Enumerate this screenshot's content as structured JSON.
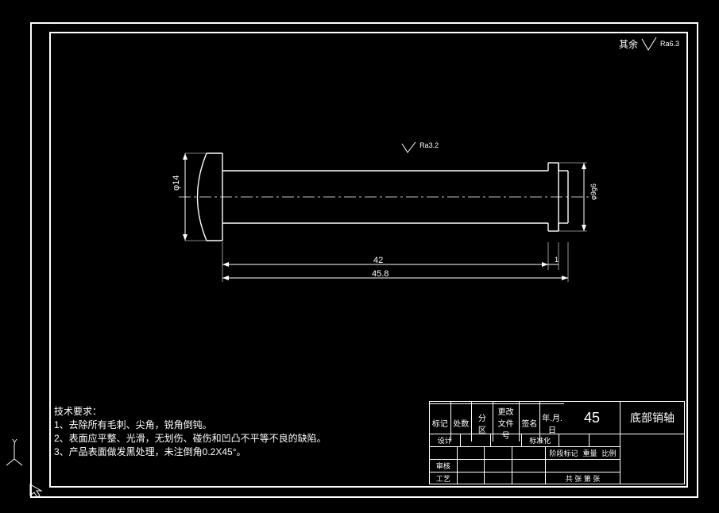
{
  "frame": {},
  "surface_finish": {
    "prefix": "其余",
    "value": "Ra6.3"
  },
  "main_roughness": "Ra3.2",
  "dimensions": {
    "d1": "φ14",
    "d2": "φ9g6",
    "len1": "42",
    "len2": "45.8",
    "len3": "1"
  },
  "tech_req": {
    "title": "技术要求：",
    "line1": "1、去除所有毛刺、尖角，锐角倒钝。",
    "line2": "2、表面应平整、光滑，无划伤、碰伤和凹凸不平等不良的缺陷。",
    "line3": "3、产品表面做发黑处理，未注倒角0.2X45°。"
  },
  "titleblock": {
    "material": "45",
    "part_name": "底部销轴",
    "row_hdr": {
      "c1": "标记",
      "c2": "处数",
      "c3": "分 区",
      "c4": "更改文件号",
      "c5": "签名",
      "c6": "年.月.日"
    },
    "rows": {
      "r1": "设计",
      "r1b": "标准化",
      "r2": "审核",
      "r3": "工艺"
    },
    "rlabels": {
      "a": "阶段标记",
      "b": "重量",
      "c": "比例"
    },
    "footer": "共    张 第    张"
  },
  "crosshair": "Y",
  "chart_data": {
    "type": "engineering_drawing",
    "part": "底部销轴 (bottom pin shaft)",
    "material": "45 steel",
    "overall_length_mm": 45.8,
    "main_shaft_length_mm": 42,
    "end_collar_width_mm": 1,
    "head_diameter_mm": 14,
    "shaft_diameter": "φ9g6",
    "default_surface_roughness": "Ra6.3",
    "shaft_surface_roughness": "Ra3.2",
    "unspecified_chamfer": "0.2×45°",
    "finish": "blackening treatment"
  }
}
